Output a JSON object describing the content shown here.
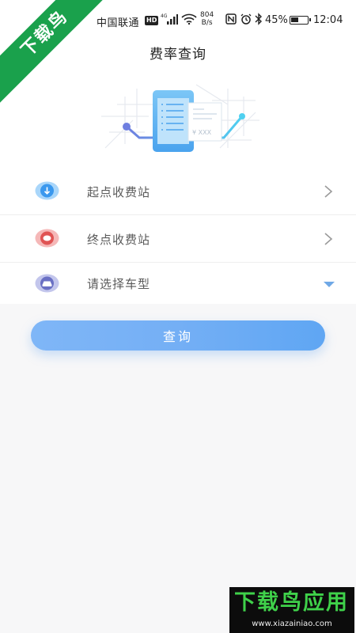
{
  "status_bar": {
    "carrier": "中国联通",
    "hd_badge": "HD",
    "net_speed_value": "804",
    "net_speed_unit": "B/s",
    "battery": "45%",
    "time": "12:04",
    "icons": [
      "signal-icon",
      "wifi-icon",
      "nfc-icon",
      "alarm-icon",
      "bluetooth-icon",
      "battery-icon"
    ]
  },
  "header": {
    "title": "费率查询"
  },
  "illustration": {
    "price_text": "¥ XXX"
  },
  "form": {
    "start_station": {
      "label": "起点收费站",
      "icon": "arrow-down-icon",
      "icon_color": "#3aa0f0"
    },
    "end_station": {
      "label": "终点收费站",
      "icon": "stop-icon",
      "icon_color": "#e05a5a"
    },
    "vehicle_type": {
      "label": "请选择车型",
      "icon": "car-icon",
      "icon_color": "#6b72c8"
    }
  },
  "actions": {
    "query_label": "查询"
  },
  "watermark": {
    "corner_text": "下载鸟",
    "bottom_text": "下载鸟应用",
    "bottom_url": "www.xiazainiao.com"
  },
  "colors": {
    "accent": "#74aff5",
    "watermark_green": "#1aa14c"
  }
}
